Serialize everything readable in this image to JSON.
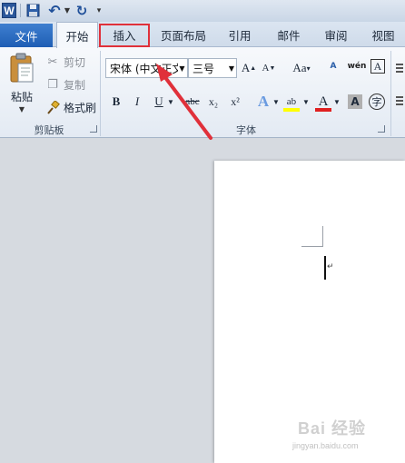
{
  "quick_access": {
    "logo_text": "W",
    "icons": [
      "word-logo-icon",
      "save-icon",
      "undo-icon",
      "redo-icon",
      "customize-qat-icon"
    ]
  },
  "tabs": {
    "file": "文件",
    "home": "开始",
    "insert": "插入",
    "page_layout": "页面布局",
    "references": "引用",
    "mailings": "邮件",
    "review": "审阅",
    "view": "视图"
  },
  "clipboard": {
    "paste": "粘贴",
    "cut": "剪切",
    "copy": "复制",
    "format_painter": "格式刷",
    "group_label": "剪贴板"
  },
  "font": {
    "font_name": "宋体 (中文正文",
    "font_size": "三号",
    "grow": "A",
    "shrink": "A",
    "change_case": "Aa",
    "clear_format": "A",
    "phonetic_guide": "wén",
    "char_border": "A",
    "bold": "B",
    "italic": "I",
    "underline": "U",
    "strikethrough": "abc",
    "subscript": "x₂",
    "superscript": "x²",
    "text_effect": "A",
    "highlight": "ab",
    "font_color": "A",
    "char_shading": "A",
    "enclose_char": "字",
    "group_label": "字体",
    "colors": {
      "highlight": "#ffff00",
      "font_color": "#e02020"
    }
  },
  "document": {
    "paragraph_mark": "↵"
  },
  "watermark": {
    "main": "Bai 经验",
    "sub": "jingyan.baidu.com"
  },
  "annotation": {
    "highlight_color": "#e0303a",
    "target": "insert-tab"
  }
}
